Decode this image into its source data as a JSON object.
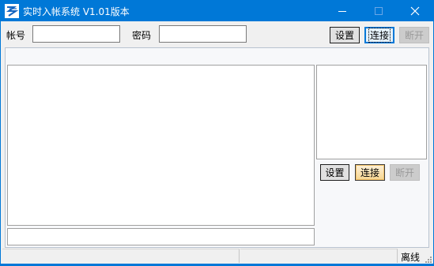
{
  "window": {
    "title": "实时入帐系统 V1.01版本"
  },
  "login": {
    "account_label": "帐号",
    "account_value": "",
    "password_label": "密码",
    "password_value": ""
  },
  "toolbar_top": {
    "settings_label": "设置",
    "connect_label": "连接",
    "disconnect_label": "断开"
  },
  "toolbar_side": {
    "settings_label": "设置",
    "connect_label": "连接",
    "disconnect_label": "断开"
  },
  "main": {
    "log_text": "",
    "side_text": "",
    "command_value": ""
  },
  "statusbar": {
    "pane1": "",
    "pane2": "",
    "state": "离线"
  },
  "colors": {
    "titlebar": "#0078d7",
    "window_bg": "#f0f0f0",
    "panel_bg": "#ffffff"
  }
}
